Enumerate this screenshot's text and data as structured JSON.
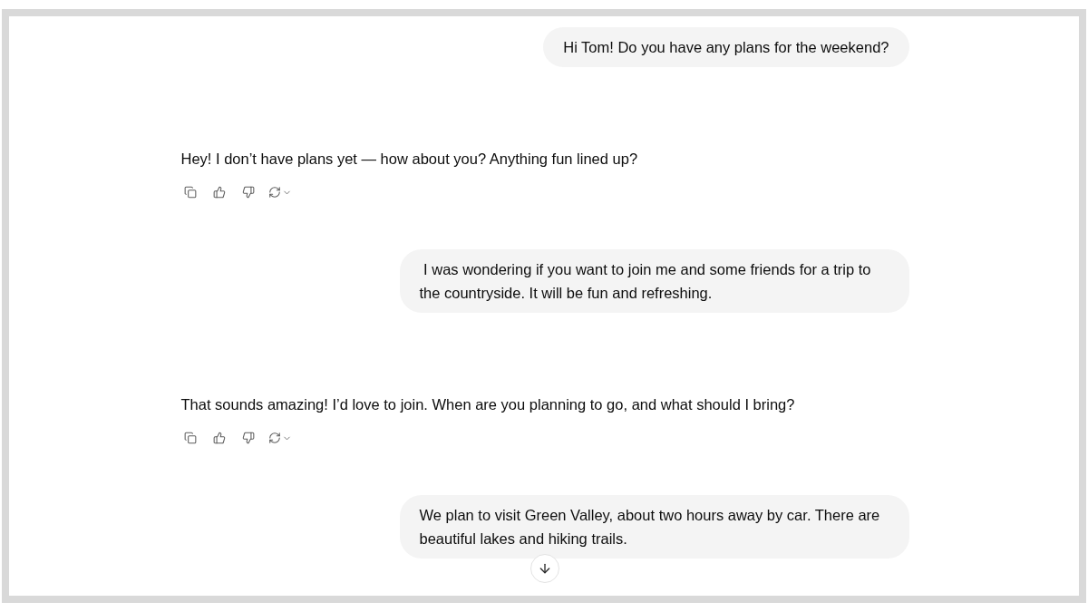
{
  "conversation": {
    "messages": [
      {
        "kind": "user",
        "text": "Hi Tom! Do you have any plans for the weekend?"
      },
      {
        "kind": "assistant",
        "text": "Hey! I don’t have plans yet — how about you? Anything fun lined up?"
      },
      {
        "kind": "user",
        "text": " I was wondering if you want to join me and some friends for a trip to the countryside. It will be fun and refreshing."
      },
      {
        "kind": "assistant",
        "text": "That sounds amazing! I’d love to join. When are you planning to go, and what should I bring?"
      },
      {
        "kind": "user",
        "text": "We plan to visit Green Valley, about two hours away by car. There are beautiful lakes and hiking trails."
      }
    ]
  }
}
